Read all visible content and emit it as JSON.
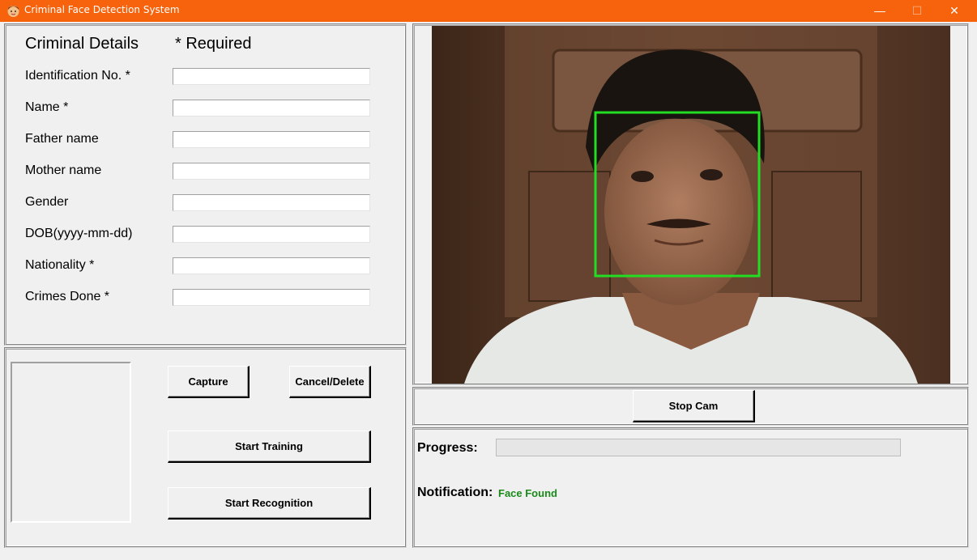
{
  "window": {
    "title": "Criminal Face Detection System",
    "controls": {
      "minimize": "—",
      "maximize": "☐",
      "close": "✕"
    },
    "accent": "#f7630c"
  },
  "details": {
    "heading": "Criminal Details",
    "required_note": "* Required",
    "fields": [
      {
        "label": "Identification No. *",
        "value": ""
      },
      {
        "label": "Name *",
        "value": ""
      },
      {
        "label": "Father name",
        "value": ""
      },
      {
        "label": "Mother name",
        "value": ""
      },
      {
        "label": "Gender",
        "value": ""
      },
      {
        "label": "DOB(yyyy-mm-dd)",
        "value": ""
      },
      {
        "label": "Nationality *",
        "value": ""
      },
      {
        "label": "Crimes Done *",
        "value": ""
      }
    ]
  },
  "actions": {
    "capture": "Capture",
    "cancel_delete": "Cancel/Delete",
    "start_training": "Start Training",
    "start_recognition": "Start Recognition"
  },
  "camera": {
    "stop_cam": "Stop Cam",
    "face_box_color": "#22dd22"
  },
  "status": {
    "progress_label": "Progress:",
    "progress_value": 0,
    "notification_label": "Notification:",
    "notification_text": "Face Found",
    "notification_color": "#1a8a1a"
  }
}
